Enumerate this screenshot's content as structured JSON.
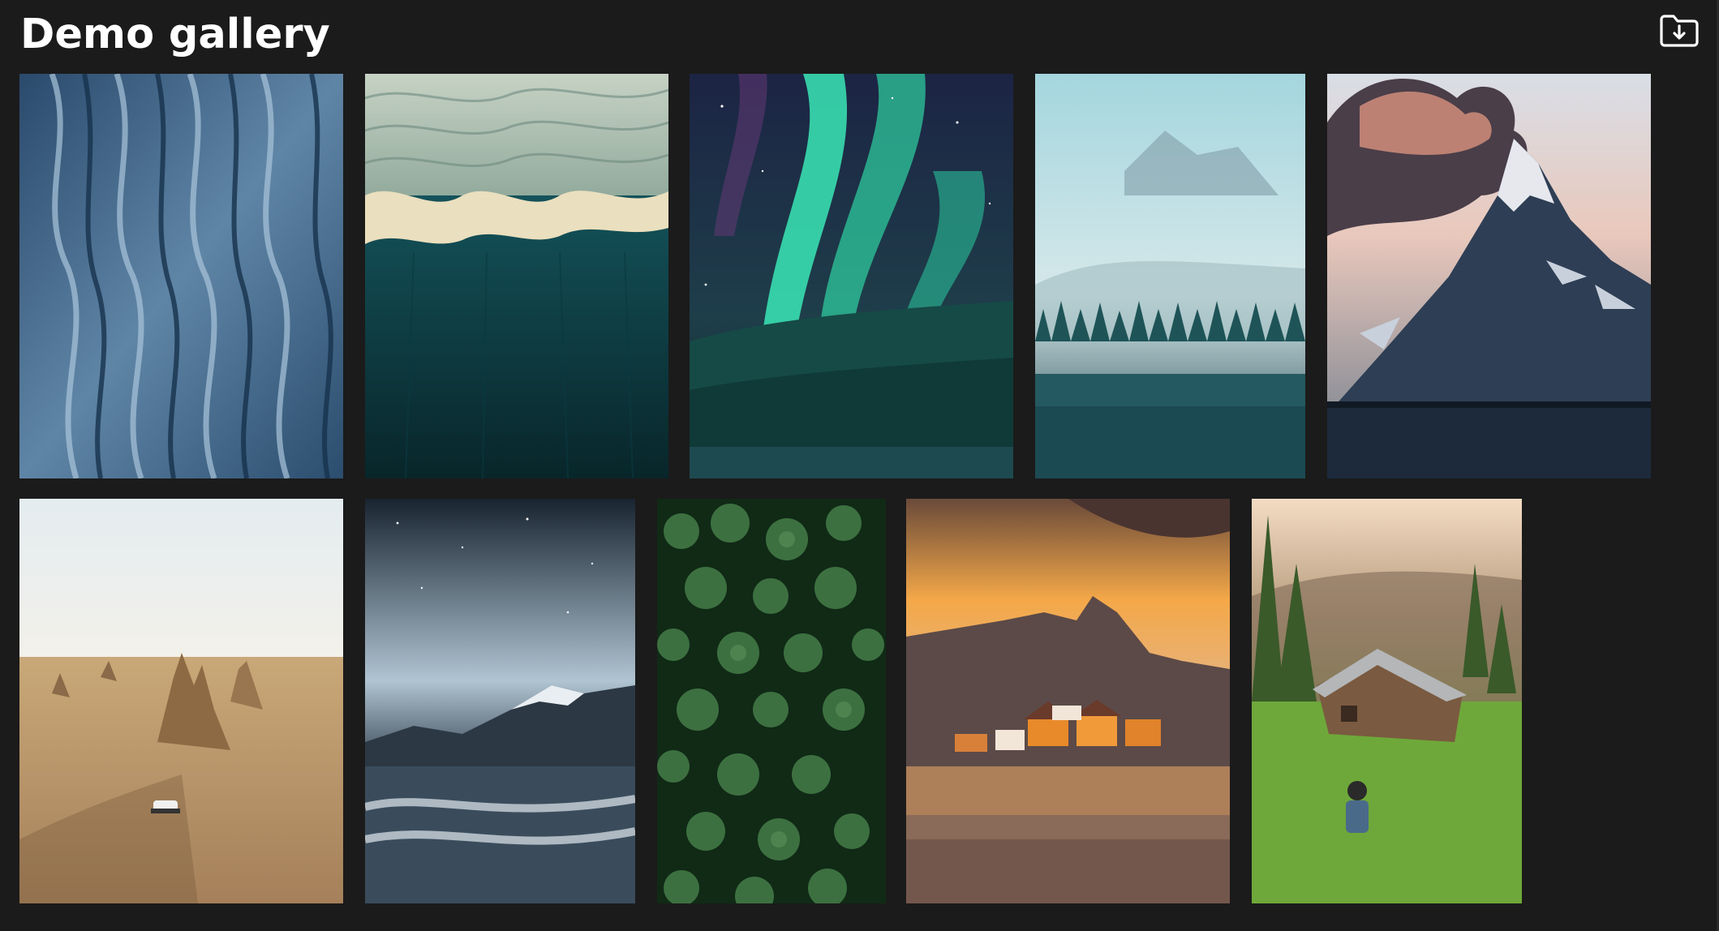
{
  "header": {
    "title": "Demo gallery",
    "download_icon": "folder-download-icon"
  },
  "gallery": {
    "rows": [
      {
        "images": [
          {
            "subject": "aerial-blue-ridges",
            "palette": [
              "#1f3d5a",
              "#5f85a6",
              "#a7c3d8"
            ]
          },
          {
            "subject": "aerial-ice-and-ocean",
            "palette": [
              "#0d3a40",
              "#e4dcc0",
              "#b9c5b0"
            ]
          },
          {
            "subject": "northern-lights-forest",
            "palette": [
              "#1a2540",
              "#34e0b0",
              "#0e3a3a"
            ]
          },
          {
            "subject": "misty-mountain-lake",
            "palette": [
              "#8fc6cf",
              "#1e5c60",
              "#143a44"
            ]
          },
          {
            "subject": "volcanic-mountain-dusk",
            "palette": [
              "#e8c4b8",
              "#2c3e56",
              "#1c2a3a"
            ]
          }
        ]
      },
      {
        "images": [
          {
            "subject": "desert-rock-pinnacles",
            "palette": [
              "#dfe6ea",
              "#c49a68",
              "#8a6a45"
            ]
          },
          {
            "subject": "night-sky-river",
            "palette": [
              "#1a2530",
              "#c8d4de",
              "#2a3a48"
            ]
          },
          {
            "subject": "aerial-pine-forest",
            "palette": [
              "#0e2a14",
              "#3a6e3c",
              "#1c3a20"
            ]
          },
          {
            "subject": "sunset-fishing-village",
            "palette": [
              "#f2a040",
              "#5a4a44",
              "#d07a2a"
            ]
          },
          {
            "subject": "mountain-cabin-meadow",
            "palette": [
              "#f0d8c0",
              "#5aa02a",
              "#6a4a32"
            ]
          }
        ]
      }
    ]
  }
}
